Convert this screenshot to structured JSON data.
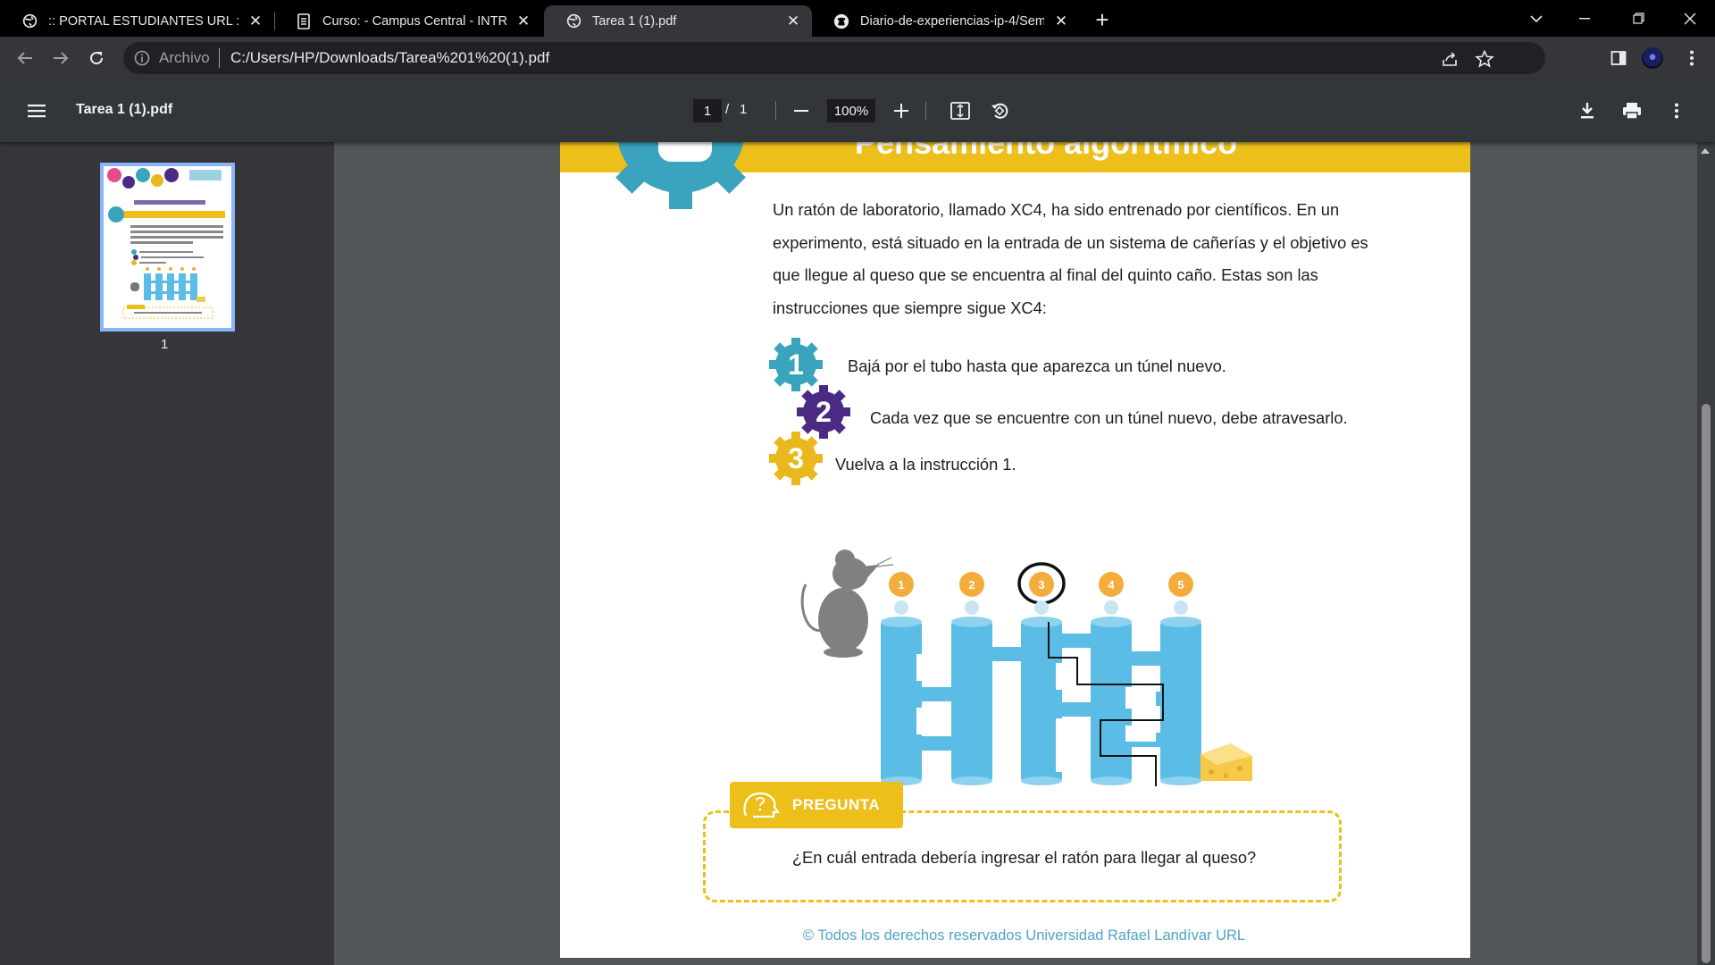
{
  "tabs": [
    {
      "title": ":: PORTAL ESTUDIANTES URL ::",
      "icon": "globe-icon"
    },
    {
      "title": "Curso: - Campus Central - INTRO",
      "icon": "document-icon"
    },
    {
      "title": "Tarea 1 (1).pdf",
      "icon": "globe-icon"
    },
    {
      "title": "Diario-de-experiencias-ip-4/Sem",
      "icon": "github-icon"
    }
  ],
  "address": {
    "scheme": "Archivo",
    "url": "C:/Users/HP/Downloads/Tarea%201%20(1).pdf"
  },
  "pdf": {
    "title": "Tarea 1 (1).pdf",
    "page_current": "1",
    "page_total": "1",
    "zoom": "100%",
    "thumb_label": "1"
  },
  "document": {
    "banner_title": "Pensamiento algorítmico",
    "intro": "Un ratón de laboratorio, llamado XC4, ha sido entrenado por científicos. En un experimento, está situado en la entrada de un sistema de cañerías y el objetivo es que llegue al queso que se encuentra al final del quinto caño. Estas son las instrucciones que siempre sigue XC4:",
    "steps": [
      {
        "num": "1",
        "text": "Bajá por el tubo hasta que aparezca un túnel nuevo.",
        "color": "#3aa3bd"
      },
      {
        "num": "2",
        "text": "Cada vez que se encuentre con un túnel nuevo, debe atravesarlo.",
        "color": "#4b2a84"
      },
      {
        "num": "3",
        "text": "Vuelva a la instrucción 1.",
        "color": "#e9b81c"
      }
    ],
    "pipe_labels": [
      "1",
      "2",
      "3",
      "4",
      "5"
    ],
    "question_label": "PREGUNTA",
    "question": "¿En cuál entrada debería ingresar el ratón para llegar al queso?",
    "footer": "© Todos los derechos reservados Universidad Rafael Landívar URL"
  },
  "colors": {
    "accent_yellow": "#ecbf1b",
    "pipe_blue": "#5bbde6",
    "teal": "#3aa3bd",
    "purple": "#4b2a84",
    "footer_blue": "#4fa4c6"
  }
}
